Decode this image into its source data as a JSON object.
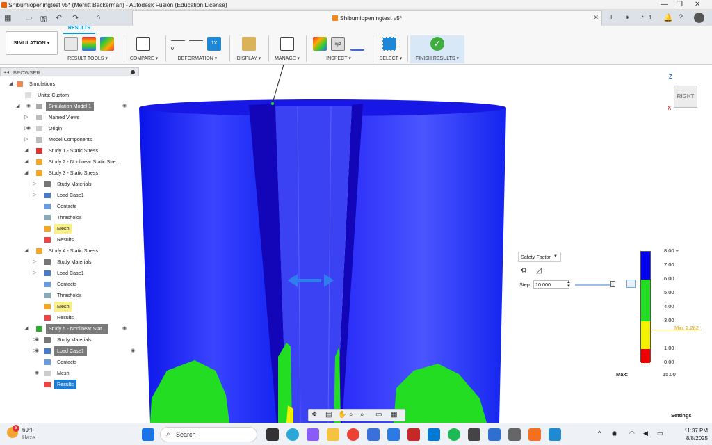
{
  "window": {
    "title": "Shibumiopeningtest v5* (Merritt Backerman) - Autodesk Fusion (Education License)"
  },
  "document_tab": {
    "title": "Shibumiopeningtest v5*"
  },
  "qat": {
    "notif_count": "1"
  },
  "ribbon": {
    "workspace": "SIMULATION",
    "active_tab": "RESULTS",
    "groups": {
      "result_tools": "RESULT TOOLS",
      "compare": "COMPARE",
      "deformation": "DEFORMATION",
      "display": "DISPLAY",
      "manage": "MANAGE",
      "inspect": "INSPECT",
      "select": "SELECT",
      "finish": "FINISH RESULTS"
    },
    "deformation_labels": {
      "zero": "0",
      "one_x": "1X"
    }
  },
  "browser": {
    "title": "BROWSER",
    "items": [
      {
        "label": "Simulations"
      },
      {
        "label": "Units: Custom"
      },
      {
        "label": "Simulation Model 1"
      },
      {
        "label": "Named Views"
      },
      {
        "label": "Origin"
      },
      {
        "label": "Model Components"
      },
      {
        "label": "Study 1 - Static Stress"
      },
      {
        "label": "Study 2 - Nonlinear Static Stre..."
      },
      {
        "label": "Study 3 - Static Stress"
      },
      {
        "label": "Study Materials"
      },
      {
        "label": "Load Case1"
      },
      {
        "label": "Contacts"
      },
      {
        "label": "Thresholds"
      },
      {
        "label": "Mesh"
      },
      {
        "label": "Results"
      },
      {
        "label": "Study 4 - Static Stress"
      },
      {
        "label": "Study Materials"
      },
      {
        "label": "Load Case1"
      },
      {
        "label": "Contacts"
      },
      {
        "label": "Thresholds"
      },
      {
        "label": "Mesh"
      },
      {
        "label": "Results"
      },
      {
        "label": "Study 5 - Nonlinear Stat..."
      },
      {
        "label": "Study Materials"
      },
      {
        "label": "Load Case1"
      },
      {
        "label": "Contacts"
      },
      {
        "label": "Mesh"
      },
      {
        "label": "Results"
      }
    ]
  },
  "viewcube": {
    "face": "RIGHT",
    "z": "Z",
    "x": "X"
  },
  "legend": {
    "result_type": "Safety Factor",
    "step_label": "Step",
    "step_value": "10.000",
    "step_fraction": 1.0,
    "ticks": [
      "8.00 +",
      "7.00",
      "6.00",
      "5.00",
      "4.00",
      "3.00",
      "1.00",
      "0.00"
    ],
    "min_label": "Min: 2.282",
    "max_label": "Max:",
    "max_value": "15.00",
    "colors": {
      "blue": "#0000ee",
      "green": "#22dd22",
      "yellow": "#f2f200",
      "red": "#ee0000"
    }
  },
  "settings_label": "Settings",
  "taskbar": {
    "weather_temp": "69°F",
    "weather_desc": "Haze",
    "weather_badge": "8",
    "search_placeholder": "Search",
    "time": "11:37 PM",
    "date": "8/8/2025"
  }
}
